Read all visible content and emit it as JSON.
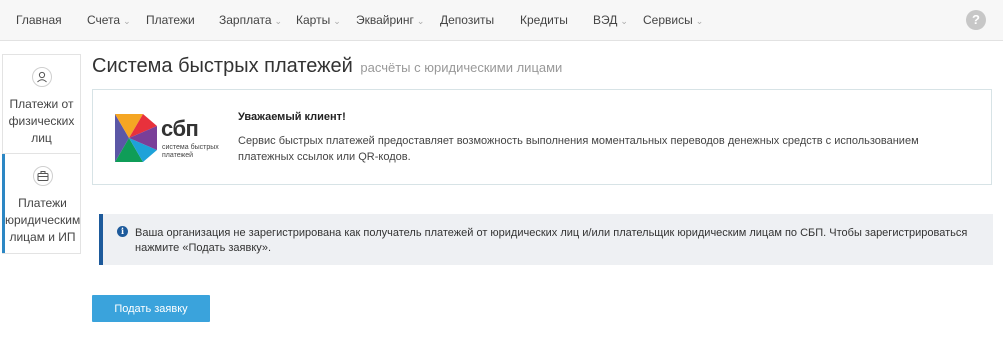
{
  "nav": {
    "items": [
      {
        "label": "Главная",
        "has_dropdown": false
      },
      {
        "label": "Счета",
        "has_dropdown": true
      },
      {
        "label": "Платежи",
        "has_dropdown": false
      },
      {
        "label": "Зарплата",
        "has_dropdown": true
      },
      {
        "label": "Карты",
        "has_dropdown": true
      },
      {
        "label": "Эквайринг",
        "has_dropdown": true
      },
      {
        "label": "Депозиты",
        "has_dropdown": false
      },
      {
        "label": "Кредиты",
        "has_dropdown": false
      },
      {
        "label": "ВЭД",
        "has_dropdown": true
      },
      {
        "label": "Сервисы",
        "has_dropdown": true
      }
    ],
    "help_icon": "?"
  },
  "sidebar": {
    "tabs": [
      {
        "label": "Платежи от физических лиц",
        "icon": "person-icon",
        "active": false
      },
      {
        "label": "Платежи юридическим лицам и ИП",
        "icon": "briefcase-icon",
        "active": true
      }
    ]
  },
  "page": {
    "title": "Система быстрых платежей",
    "subtitle": "расчёты с юридическими лицами"
  },
  "sbp_card": {
    "logo_text": "сбп",
    "logo_subtext_line1": "система быстрых",
    "logo_subtext_line2": "платежей",
    "heading": "Уважаемый клиент!",
    "text": "Сервис быстрых платежей предоставляет возможность выполнения моментальных переводов денежных средств с использованием платежных ссылок или QR-кодов."
  },
  "notice": {
    "icon": "i",
    "text": "Ваша организация не зарегистрирована как получатель платежей от юридических лиц и/или плательщик юридическим лицам по СБП. Чтобы зарегистрироваться нажмите «Подать заявку»."
  },
  "actions": {
    "apply_label": "Подать заявку"
  },
  "colors": {
    "accent": "#3aa3dc",
    "notice_border": "#1d5a9b",
    "active_tab_border": "#2c87c4"
  }
}
